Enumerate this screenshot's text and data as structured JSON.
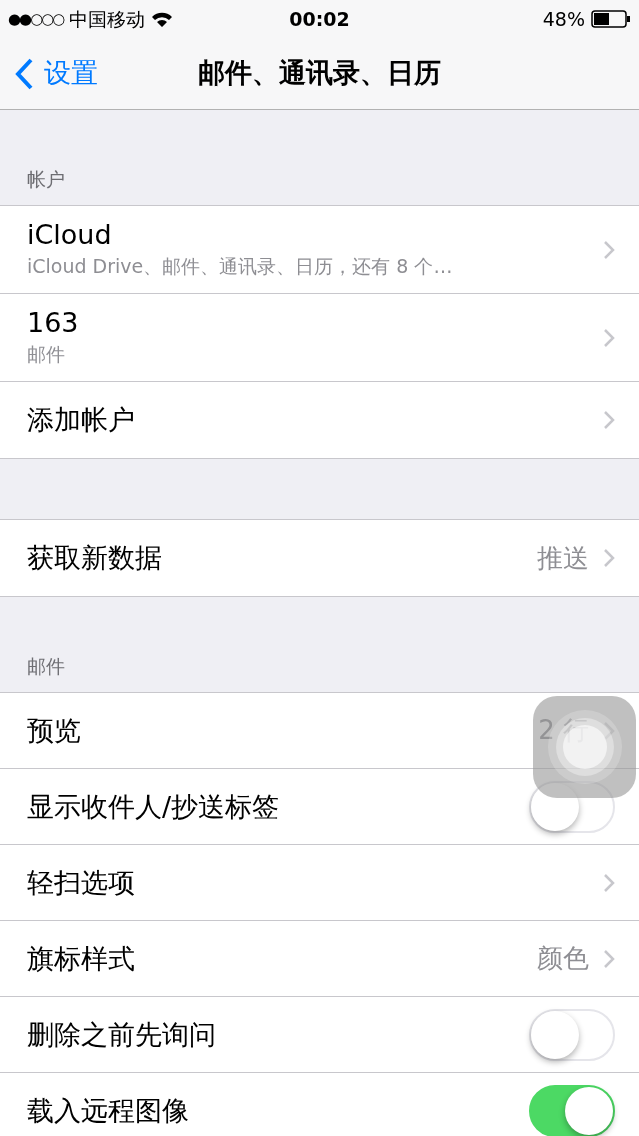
{
  "status_bar": {
    "signal_dots": "●●○○○",
    "carrier": "中国移动",
    "time": "00:02",
    "battery": "48%"
  },
  "nav": {
    "back": "设置",
    "title": "邮件、通讯录、日历"
  },
  "groups": [
    {
      "header": "帐户",
      "rows": [
        {
          "kind": "nav",
          "label": "iCloud",
          "subtitle": "iCloud Drive、邮件、通讯录、日历，还有 8 个…"
        },
        {
          "kind": "nav",
          "label": "163",
          "subtitle": "邮件"
        },
        {
          "kind": "nav",
          "label": "添加帐户"
        }
      ]
    },
    {
      "rows": [
        {
          "kind": "nav",
          "label": "获取新数据",
          "detail": "推送"
        }
      ]
    },
    {
      "header": "邮件",
      "rows": [
        {
          "kind": "nav",
          "label": "预览",
          "detail": "2 行"
        },
        {
          "kind": "toggle",
          "label": "显示收件人/抄送标签",
          "on": false
        },
        {
          "kind": "nav",
          "label": "轻扫选项"
        },
        {
          "kind": "nav",
          "label": "旗标样式",
          "detail": "颜色"
        },
        {
          "kind": "toggle",
          "label": "删除之前先询问",
          "on": false
        },
        {
          "kind": "toggle",
          "label": "载入远程图像",
          "on": true
        }
      ]
    }
  ]
}
